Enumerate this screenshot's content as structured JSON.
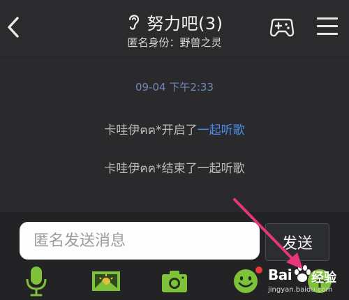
{
  "header": {
    "back_icon": "chevron-left-icon",
    "title": "努力吧(3)",
    "title_icon": "ear-icon",
    "subtitle": "匿名身份：野兽之灵",
    "game_icon": "gamepad-icon",
    "menu_icon": "hamburger-menu-icon"
  },
  "chat": {
    "timestamp": "09-04 下午2:33",
    "messages": [
      {
        "prefix": "卡哇伊ฅฅ*开启了",
        "link": "一起听歌"
      },
      {
        "text": "卡哇伊ฅฅ*结束了一起听歌"
      }
    ]
  },
  "composer": {
    "placeholder": "匿名发送消息",
    "value": "",
    "send_label": "发送"
  },
  "toolbar": {
    "items": [
      {
        "name": "microphone",
        "icon": "microphone-icon"
      },
      {
        "name": "picture",
        "icon": "picture-icon"
      },
      {
        "name": "camera",
        "icon": "camera-icon"
      },
      {
        "name": "emoji",
        "icon": "emoji-icon",
        "badge": true
      },
      {
        "name": "more",
        "icon": "more-icon"
      }
    ]
  },
  "watermark": {
    "brand": "Bai",
    "brand_suffix": "经验",
    "url": "jingyan.baidu.com"
  },
  "colors": {
    "background": "#2a2a2c",
    "link": "#4c8df0",
    "timestamp": "#6e89b8",
    "accent_green": "#7ec23a",
    "badge_red": "#e83a3a",
    "annotation_pink": "#e8367a"
  }
}
